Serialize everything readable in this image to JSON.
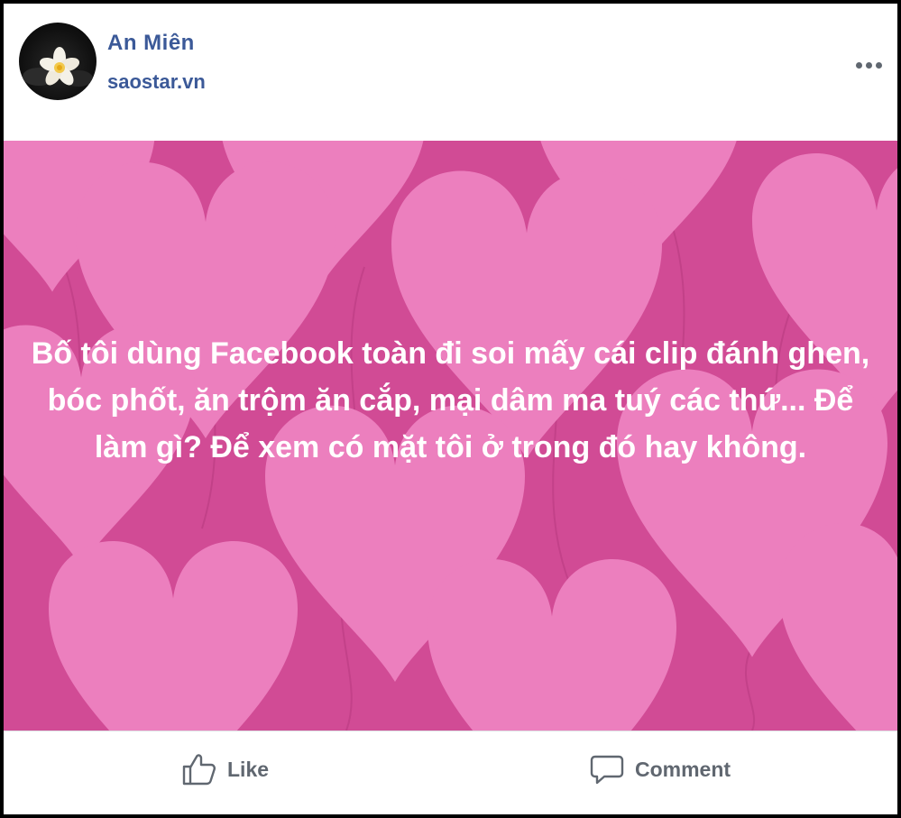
{
  "header": {
    "author_name": "An Miên",
    "source": "saostar.vn",
    "avatar_icon": "plumeria-flower-avatar",
    "more_icon": "more-options-icon"
  },
  "post": {
    "text": "Bố tôi dùng Facebook toàn đi soi mấy cái clip đánh ghen, bóc phốt, ăn trộm ăn cắp, mại dâm ma tuý các thứ... Để làm gì? Để xem có mặt tôi ở trong đó hay không.",
    "background_color": "#d14b95",
    "heart_color": "#ec7fbe"
  },
  "actions": {
    "like_label": "Like",
    "like_icon": "thumbs-up-icon",
    "comment_label": "Comment",
    "comment_icon": "comment-bubble-icon"
  },
  "colors": {
    "author_link": "#3b5998",
    "action_text": "#606770"
  }
}
